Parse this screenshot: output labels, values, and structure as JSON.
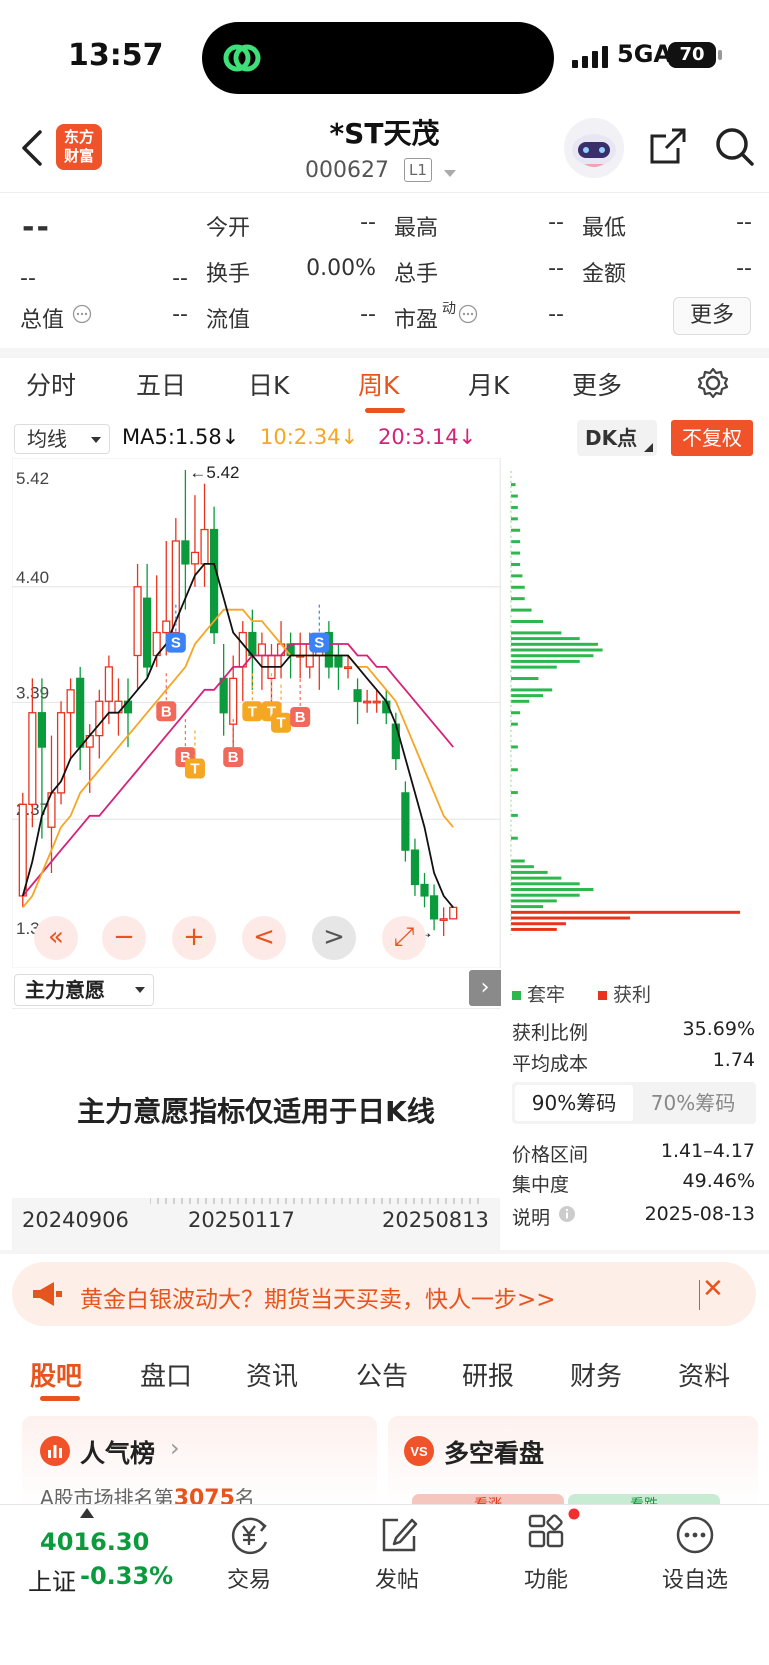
{
  "status": {
    "time": "13:57",
    "network": "5GA",
    "battery": "70"
  },
  "header": {
    "logo_line1": "东方",
    "logo_line2": "财富",
    "title": "*ST天茂",
    "code": "000627",
    "level": "L1"
  },
  "quote": {
    "price": "--",
    "change": "--",
    "change_pct": "--",
    "open_label": "今开",
    "open": "--",
    "high_label": "最高",
    "high": "--",
    "low_label": "最低",
    "low": "--",
    "turnover_label": "换手",
    "turnover": "0.00%",
    "volume_label": "总手",
    "volume": "--",
    "amount_label": "金额",
    "amount": "--",
    "mktcap_label": "总值",
    "mktcap": "--",
    "float_label": "流值",
    "float_cap": "--",
    "pe_label": "市盈",
    "pe_sup": "动",
    "pe": "--",
    "more_label": "更多"
  },
  "period_tabs": [
    "分时",
    "五日",
    "日K",
    "周K",
    "月K",
    "更多"
  ],
  "active_period": "周K",
  "ma_row": {
    "select": "均线",
    "ma5": "MA5:1.58↓",
    "ma10": "10:2.34↓",
    "ma20": "20:3.14↓",
    "dk": "DK点",
    "adjust": "不复权"
  },
  "colors": {
    "up": "#e8341e",
    "down": "#0b9a3c",
    "ma5": "#111111",
    "ma10": "#f5a623",
    "ma20": "#d6217a",
    "accent": "#e8541e"
  },
  "chart_data": {
    "type": "candlestick",
    "y_ticks": [
      "5.42",
      "4.40",
      "3.39",
      "2.37",
      "1.35"
    ],
    "ylim": [
      1.35,
      5.42
    ],
    "max_label": "←5.42",
    "min_label": "1.35→",
    "candles": [
      {
        "o": 1.7,
        "c": 2.5,
        "h": 2.6,
        "l": 1.6
      },
      {
        "o": 2.5,
        "c": 3.3,
        "h": 3.6,
        "l": 2.3
      },
      {
        "o": 3.3,
        "c": 3.0,
        "h": 3.6,
        "l": 2.2
      },
      {
        "o": 2.3,
        "c": 2.6,
        "h": 3.1,
        "l": 1.9
      },
      {
        "o": 2.6,
        "c": 3.3,
        "h": 3.4,
        "l": 2.5
      },
      {
        "o": 3.3,
        "c": 3.5,
        "h": 3.6,
        "l": 2.9
      },
      {
        "o": 3.6,
        "c": 3.0,
        "h": 3.7,
        "l": 2.8
      },
      {
        "o": 3.0,
        "c": 3.1,
        "h": 3.2,
        "l": 2.6
      },
      {
        "o": 3.1,
        "c": 3.4,
        "h": 3.5,
        "l": 2.9
      },
      {
        "o": 3.4,
        "c": 3.7,
        "h": 3.8,
        "l": 3.2
      },
      {
        "o": 3.3,
        "c": 3.4,
        "h": 3.6,
        "l": 3.1
      },
      {
        "o": 3.4,
        "c": 3.3,
        "h": 3.6,
        "l": 3.0
      },
      {
        "o": 3.8,
        "c": 4.4,
        "h": 4.6,
        "l": 3.5
      },
      {
        "o": 4.3,
        "c": 3.7,
        "h": 4.6,
        "l": 3.6
      },
      {
        "o": 3.8,
        "c": 4.0,
        "h": 4.5,
        "l": 3.7
      },
      {
        "o": 4.0,
        "c": 4.1,
        "h": 4.8,
        "l": 3.8
      },
      {
        "o": 4.0,
        "c": 4.8,
        "h": 5.0,
        "l": 3.9
      },
      {
        "o": 4.8,
        "c": 4.6,
        "h": 5.42,
        "l": 4.2
      },
      {
        "o": 4.6,
        "c": 4.7,
        "h": 5.2,
        "l": 4.4
      },
      {
        "o": 4.6,
        "c": 4.9,
        "h": 5.3,
        "l": 4.4
      },
      {
        "o": 4.9,
        "c": 4.0,
        "h": 5.1,
        "l": 3.9
      },
      {
        "o": 3.6,
        "c": 3.3,
        "h": 3.9,
        "l": 3.1
      },
      {
        "o": 3.2,
        "c": 3.6,
        "h": 3.8,
        "l": 3.0
      },
      {
        "o": 3.7,
        "c": 4.0,
        "h": 4.1,
        "l": 3.4
      },
      {
        "o": 4.0,
        "c": 3.8,
        "h": 4.2,
        "l": 3.5
      },
      {
        "o": 3.8,
        "c": 3.9,
        "h": 4.0,
        "l": 3.5
      },
      {
        "o": 3.6,
        "c": 3.8,
        "h": 3.9,
        "l": 3.3
      },
      {
        "o": 3.8,
        "c": 3.9,
        "h": 4.1,
        "l": 3.6
      },
      {
        "o": 3.9,
        "c": 3.8,
        "h": 4.0,
        "l": 3.6
      },
      {
        "o": 3.8,
        "c": 3.8,
        "h": 4.0,
        "l": 3.6
      },
      {
        "o": 3.7,
        "c": 3.9,
        "h": 4.0,
        "l": 3.6
      },
      {
        "o": 3.8,
        "c": 3.9,
        "h": 4.0,
        "l": 3.5
      },
      {
        "o": 4.0,
        "c": 3.7,
        "h": 4.1,
        "l": 3.6
      },
      {
        "o": 3.8,
        "c": 3.7,
        "h": 3.9,
        "l": 3.5
      },
      {
        "o": 3.7,
        "c": 3.7,
        "h": 3.8,
        "l": 3.6
      },
      {
        "o": 3.5,
        "c": 3.4,
        "h": 3.6,
        "l": 3.2
      },
      {
        "o": 3.4,
        "c": 3.4,
        "h": 3.5,
        "l": 3.3
      },
      {
        "o": 3.4,
        "c": 3.4,
        "h": 3.5,
        "l": 3.3
      },
      {
        "o": 3.4,
        "c": 3.3,
        "h": 3.5,
        "l": 3.2
      },
      {
        "o": 3.2,
        "c": 2.9,
        "h": 3.3,
        "l": 2.8
      },
      {
        "o": 2.6,
        "c": 2.1,
        "h": 2.7,
        "l": 2.0
      },
      {
        "o": 2.1,
        "c": 1.8,
        "h": 2.2,
        "l": 1.7
      },
      {
        "o": 1.8,
        "c": 1.7,
        "h": 1.9,
        "l": 1.6
      },
      {
        "o": 1.7,
        "c": 1.5,
        "h": 1.8,
        "l": 1.4
      },
      {
        "o": 1.5,
        "c": 1.5,
        "h": 1.6,
        "l": 1.35
      },
      {
        "o": 1.5,
        "c": 1.6,
        "h": 1.6,
        "l": 1.5
      }
    ],
    "ma5": [
      1.7,
      2.0,
      2.4,
      2.6,
      2.7,
      2.9,
      3.0,
      3.1,
      3.2,
      3.3,
      3.3,
      3.4,
      3.5,
      3.6,
      3.8,
      3.9,
      4.1,
      4.3,
      4.5,
      4.6,
      4.6,
      4.3,
      4.0,
      3.9,
      3.8,
      3.7,
      3.7,
      3.7,
      3.8,
      3.8,
      3.8,
      3.8,
      3.8,
      3.8,
      3.8,
      3.7,
      3.6,
      3.5,
      3.4,
      3.2,
      2.9,
      2.6,
      2.3,
      1.9,
      1.7,
      1.6
    ],
    "ma10": [
      1.6,
      1.7,
      1.9,
      2.1,
      2.3,
      2.4,
      2.6,
      2.7,
      2.8,
      2.9,
      3.0,
      3.1,
      3.2,
      3.3,
      3.4,
      3.5,
      3.6,
      3.7,
      3.9,
      4.0,
      4.1,
      4.2,
      4.2,
      4.2,
      4.1,
      4.1,
      4.0,
      3.9,
      3.8,
      3.8,
      3.8,
      3.8,
      3.8,
      3.8,
      3.8,
      3.7,
      3.7,
      3.6,
      3.5,
      3.4,
      3.2,
      3.0,
      2.8,
      2.6,
      2.4,
      2.3
    ],
    "ma20": [
      1.7,
      1.8,
      1.9,
      2.0,
      2.1,
      2.2,
      2.3,
      2.4,
      2.4,
      2.5,
      2.6,
      2.7,
      2.8,
      2.9,
      3.0,
      3.1,
      3.2,
      3.3,
      3.4,
      3.5,
      3.5,
      3.6,
      3.7,
      3.7,
      3.8,
      3.8,
      3.8,
      3.8,
      3.9,
      3.9,
      3.9,
      3.9,
      3.9,
      3.9,
      3.9,
      3.8,
      3.8,
      3.7,
      3.7,
      3.6,
      3.5,
      3.4,
      3.3,
      3.2,
      3.1,
      3.0
    ],
    "signals": [
      {
        "i": 15,
        "t": "B",
        "at": 3.4
      },
      {
        "i": 16,
        "t": "S",
        "at": 4.0
      },
      {
        "i": 17,
        "t": "B",
        "at": 3.0
      },
      {
        "i": 18,
        "t": "T",
        "at": 2.9
      },
      {
        "i": 22,
        "t": "B",
        "at": 3.0
      },
      {
        "i": 24,
        "t": "T",
        "at": 3.4
      },
      {
        "i": 26,
        "t": "T",
        "at": 3.4
      },
      {
        "i": 27,
        "t": "T",
        "at": 3.3
      },
      {
        "i": 29,
        "t": "B",
        "at": 3.35
      },
      {
        "i": 31,
        "t": "S",
        "at": 4.0
      }
    ],
    "chip_distribution": [
      {
        "price": 5.3,
        "v": 2,
        "p": false
      },
      {
        "price": 5.2,
        "v": 3,
        "p": false
      },
      {
        "price": 5.1,
        "v": 3,
        "p": false
      },
      {
        "price": 5.0,
        "v": 3,
        "p": false
      },
      {
        "price": 4.9,
        "v": 4,
        "p": false
      },
      {
        "price": 4.8,
        "v": 4,
        "p": false
      },
      {
        "price": 4.7,
        "v": 4,
        "p": false
      },
      {
        "price": 4.6,
        "v": 4,
        "p": false
      },
      {
        "price": 4.5,
        "v": 5,
        "p": false
      },
      {
        "price": 4.4,
        "v": 6,
        "p": false
      },
      {
        "price": 4.3,
        "v": 6,
        "p": false
      },
      {
        "price": 4.2,
        "v": 9,
        "p": false
      },
      {
        "price": 4.1,
        "v": 14,
        "p": false
      },
      {
        "price": 4.0,
        "v": 22,
        "p": false
      },
      {
        "price": 3.95,
        "v": 30,
        "p": false
      },
      {
        "price": 3.9,
        "v": 38,
        "p": false
      },
      {
        "price": 3.85,
        "v": 40,
        "p": false
      },
      {
        "price": 3.8,
        "v": 36,
        "p": false
      },
      {
        "price": 3.75,
        "v": 30,
        "p": false
      },
      {
        "price": 3.7,
        "v": 20,
        "p": false
      },
      {
        "price": 3.6,
        "v": 12,
        "p": false
      },
      {
        "price": 3.5,
        "v": 18,
        "p": false
      },
      {
        "price": 3.45,
        "v": 14,
        "p": false
      },
      {
        "price": 3.4,
        "v": 8,
        "p": false
      },
      {
        "price": 3.3,
        "v": 4,
        "p": false
      },
      {
        "price": 3.2,
        "v": 3,
        "p": false
      },
      {
        "price": 3.0,
        "v": 3,
        "p": false
      },
      {
        "price": 2.8,
        "v": 3,
        "p": false
      },
      {
        "price": 2.6,
        "v": 3,
        "p": false
      },
      {
        "price": 2.4,
        "v": 3,
        "p": false
      },
      {
        "price": 2.2,
        "v": 3,
        "p": false
      },
      {
        "price": 2.0,
        "v": 6,
        "p": false
      },
      {
        "price": 1.95,
        "v": 10,
        "p": false
      },
      {
        "price": 1.9,
        "v": 16,
        "p": false
      },
      {
        "price": 1.85,
        "v": 22,
        "p": false
      },
      {
        "price": 1.8,
        "v": 30,
        "p": false
      },
      {
        "price": 1.75,
        "v": 36,
        "p": false
      },
      {
        "price": 1.7,
        "v": 30,
        "p": false
      },
      {
        "price": 1.65,
        "v": 20,
        "p": false
      },
      {
        "price": 1.6,
        "v": 14,
        "p": false
      },
      {
        "price": 1.55,
        "v": 100,
        "p": true
      },
      {
        "price": 1.5,
        "v": 52,
        "p": true
      },
      {
        "price": 1.45,
        "v": 24,
        "p": true
      },
      {
        "price": 1.4,
        "v": 20,
        "p": true
      }
    ]
  },
  "controls": [
    "«",
    "−",
    "+",
    "<",
    ">",
    "⤢"
  ],
  "indicator": {
    "select": "主力意愿",
    "message": "主力意愿指标仅适用于日K线"
  },
  "dates": [
    "20240906",
    "20250117",
    "20250813"
  ],
  "chips_panel": {
    "legend_loss": "套牢",
    "legend_profit": "获利",
    "profit_ratio_label": "获利比例",
    "profit_ratio": "35.69%",
    "avg_cost_label": "平均成本",
    "avg_cost": "1.74",
    "tab90": "90%筹码",
    "tab70": "70%筹码",
    "range_label": "价格区间",
    "range": "1.41–4.17",
    "concentration_label": "集中度",
    "concentration": "49.46%",
    "note_label": "说明",
    "note_date": "2025-08-13"
  },
  "banner": {
    "text": "黄金白银波动大？期货当天买卖，快人一步>>",
    "close": "✕"
  },
  "bottom_tabs": [
    "股吧",
    "盘口",
    "资讯",
    "公告",
    "研报",
    "财务",
    "资料"
  ],
  "cards": {
    "popularity_title": "人气榜",
    "popularity_sub_prefix": "A股市场排名第",
    "popularity_rank": "3075",
    "popularity_sub_suffix": "名",
    "bullbear_title": "多空看盘",
    "bull_label": "看涨",
    "bear_label": "看跌"
  },
  "bottom_nav": {
    "index_value": "4016.30",
    "index_name": "上证",
    "index_pct": "-0.33%",
    "trade": "交易",
    "post": "发帖",
    "func": "功能",
    "watch": "设自选"
  }
}
